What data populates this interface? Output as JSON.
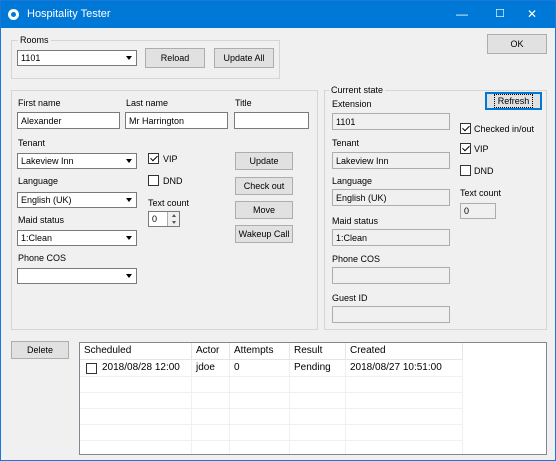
{
  "window": {
    "title": "Hospitality Tester",
    "minimize": "—",
    "maximize": "☐",
    "close": "✕"
  },
  "rooms": {
    "group_label": "Rooms",
    "selected": "1101",
    "reload_label": "Reload",
    "update_all_label": "Update All"
  },
  "ok_label": "OK",
  "guest": {
    "first_name_label": "First name",
    "first_name": "Alexander",
    "last_name_label": "Last name",
    "last_name": "Mr Harrington",
    "title_label": "Title",
    "title": "",
    "tenant_label": "Tenant",
    "tenant": "Lakeview Inn",
    "language_label": "Language",
    "language": "English (UK)",
    "maid_status_label": "Maid status",
    "maid_status": "1:Clean",
    "phone_cos_label": "Phone COS",
    "phone_cos": "",
    "vip_label": "VIP",
    "vip_checked": true,
    "dnd_label": "DND",
    "dnd_checked": false,
    "text_count_label": "Text count",
    "text_count": "0",
    "update_label": "Update",
    "check_out_label": "Check out",
    "move_label": "Move",
    "wakeup_call_label": "Wakeup Call"
  },
  "current_state": {
    "group_label": "Current state",
    "refresh_label": "Refresh",
    "extension_label": "Extension",
    "extension": "1101",
    "tenant_label": "Tenant",
    "tenant": "Lakeview Inn",
    "language_label": "Language",
    "language": "English (UK)",
    "maid_status_label": "Maid status",
    "maid_status": "1:Clean",
    "phone_cos_label": "Phone COS",
    "phone_cos": "",
    "guest_id_label": "Guest ID",
    "guest_id": "",
    "checked_in_label": "Checked in/out",
    "checked_in": true,
    "vip_label": "VIP",
    "vip_checked": true,
    "dnd_label": "DND",
    "dnd_checked": false,
    "text_count_label": "Text count",
    "text_count": "0"
  },
  "delete_label": "Delete",
  "wakeups": {
    "columns": [
      "Scheduled",
      "Actor",
      "Attempts",
      "Result",
      "Created"
    ],
    "rows": [
      {
        "scheduled": "2018/08/28 12:00",
        "actor": "jdoe",
        "attempts": "0",
        "result": "Pending",
        "created": "2018/08/27 10:51:00",
        "checked": false
      }
    ]
  }
}
